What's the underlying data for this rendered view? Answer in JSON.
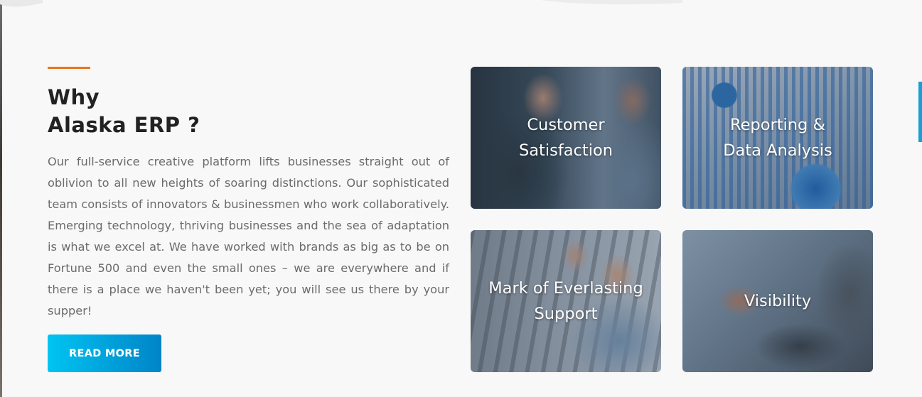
{
  "section": {
    "heading_line1": "Why",
    "heading_line2": "Alaska ERP ?",
    "body": "Our full-service creative platform lifts businesses straight out of oblivion to all new heights of soaring distinctions. Our sophisticated team consists of innovators & businessmen who work collaboratively. Emerging technology, thriving businesses and the sea of adaptation is what we excel at. We have worked with brands as big as to be on Fortune 500 and even the small ones – we are everywhere and if there is a place we haven't been yet; you will see us there by your supper!",
    "button_label": "READ MORE"
  },
  "cards": [
    {
      "line1": "Customer",
      "line2": "Satisfaction"
    },
    {
      "line1": "Reporting &",
      "line2": "Data Analysis"
    },
    {
      "line1": "Mark of Everlasting",
      "line2": "Support"
    },
    {
      "line1": "Visibility",
      "line2": ""
    }
  ],
  "colors": {
    "accent_orange": "#e8771e",
    "button_gradient_start": "#00c4f2",
    "button_gradient_end": "#0084c8",
    "heading": "#222222",
    "body_text": "#6b6b6b",
    "background": "#f8f8f8",
    "scroll_indicator": "#1a9ed4"
  }
}
